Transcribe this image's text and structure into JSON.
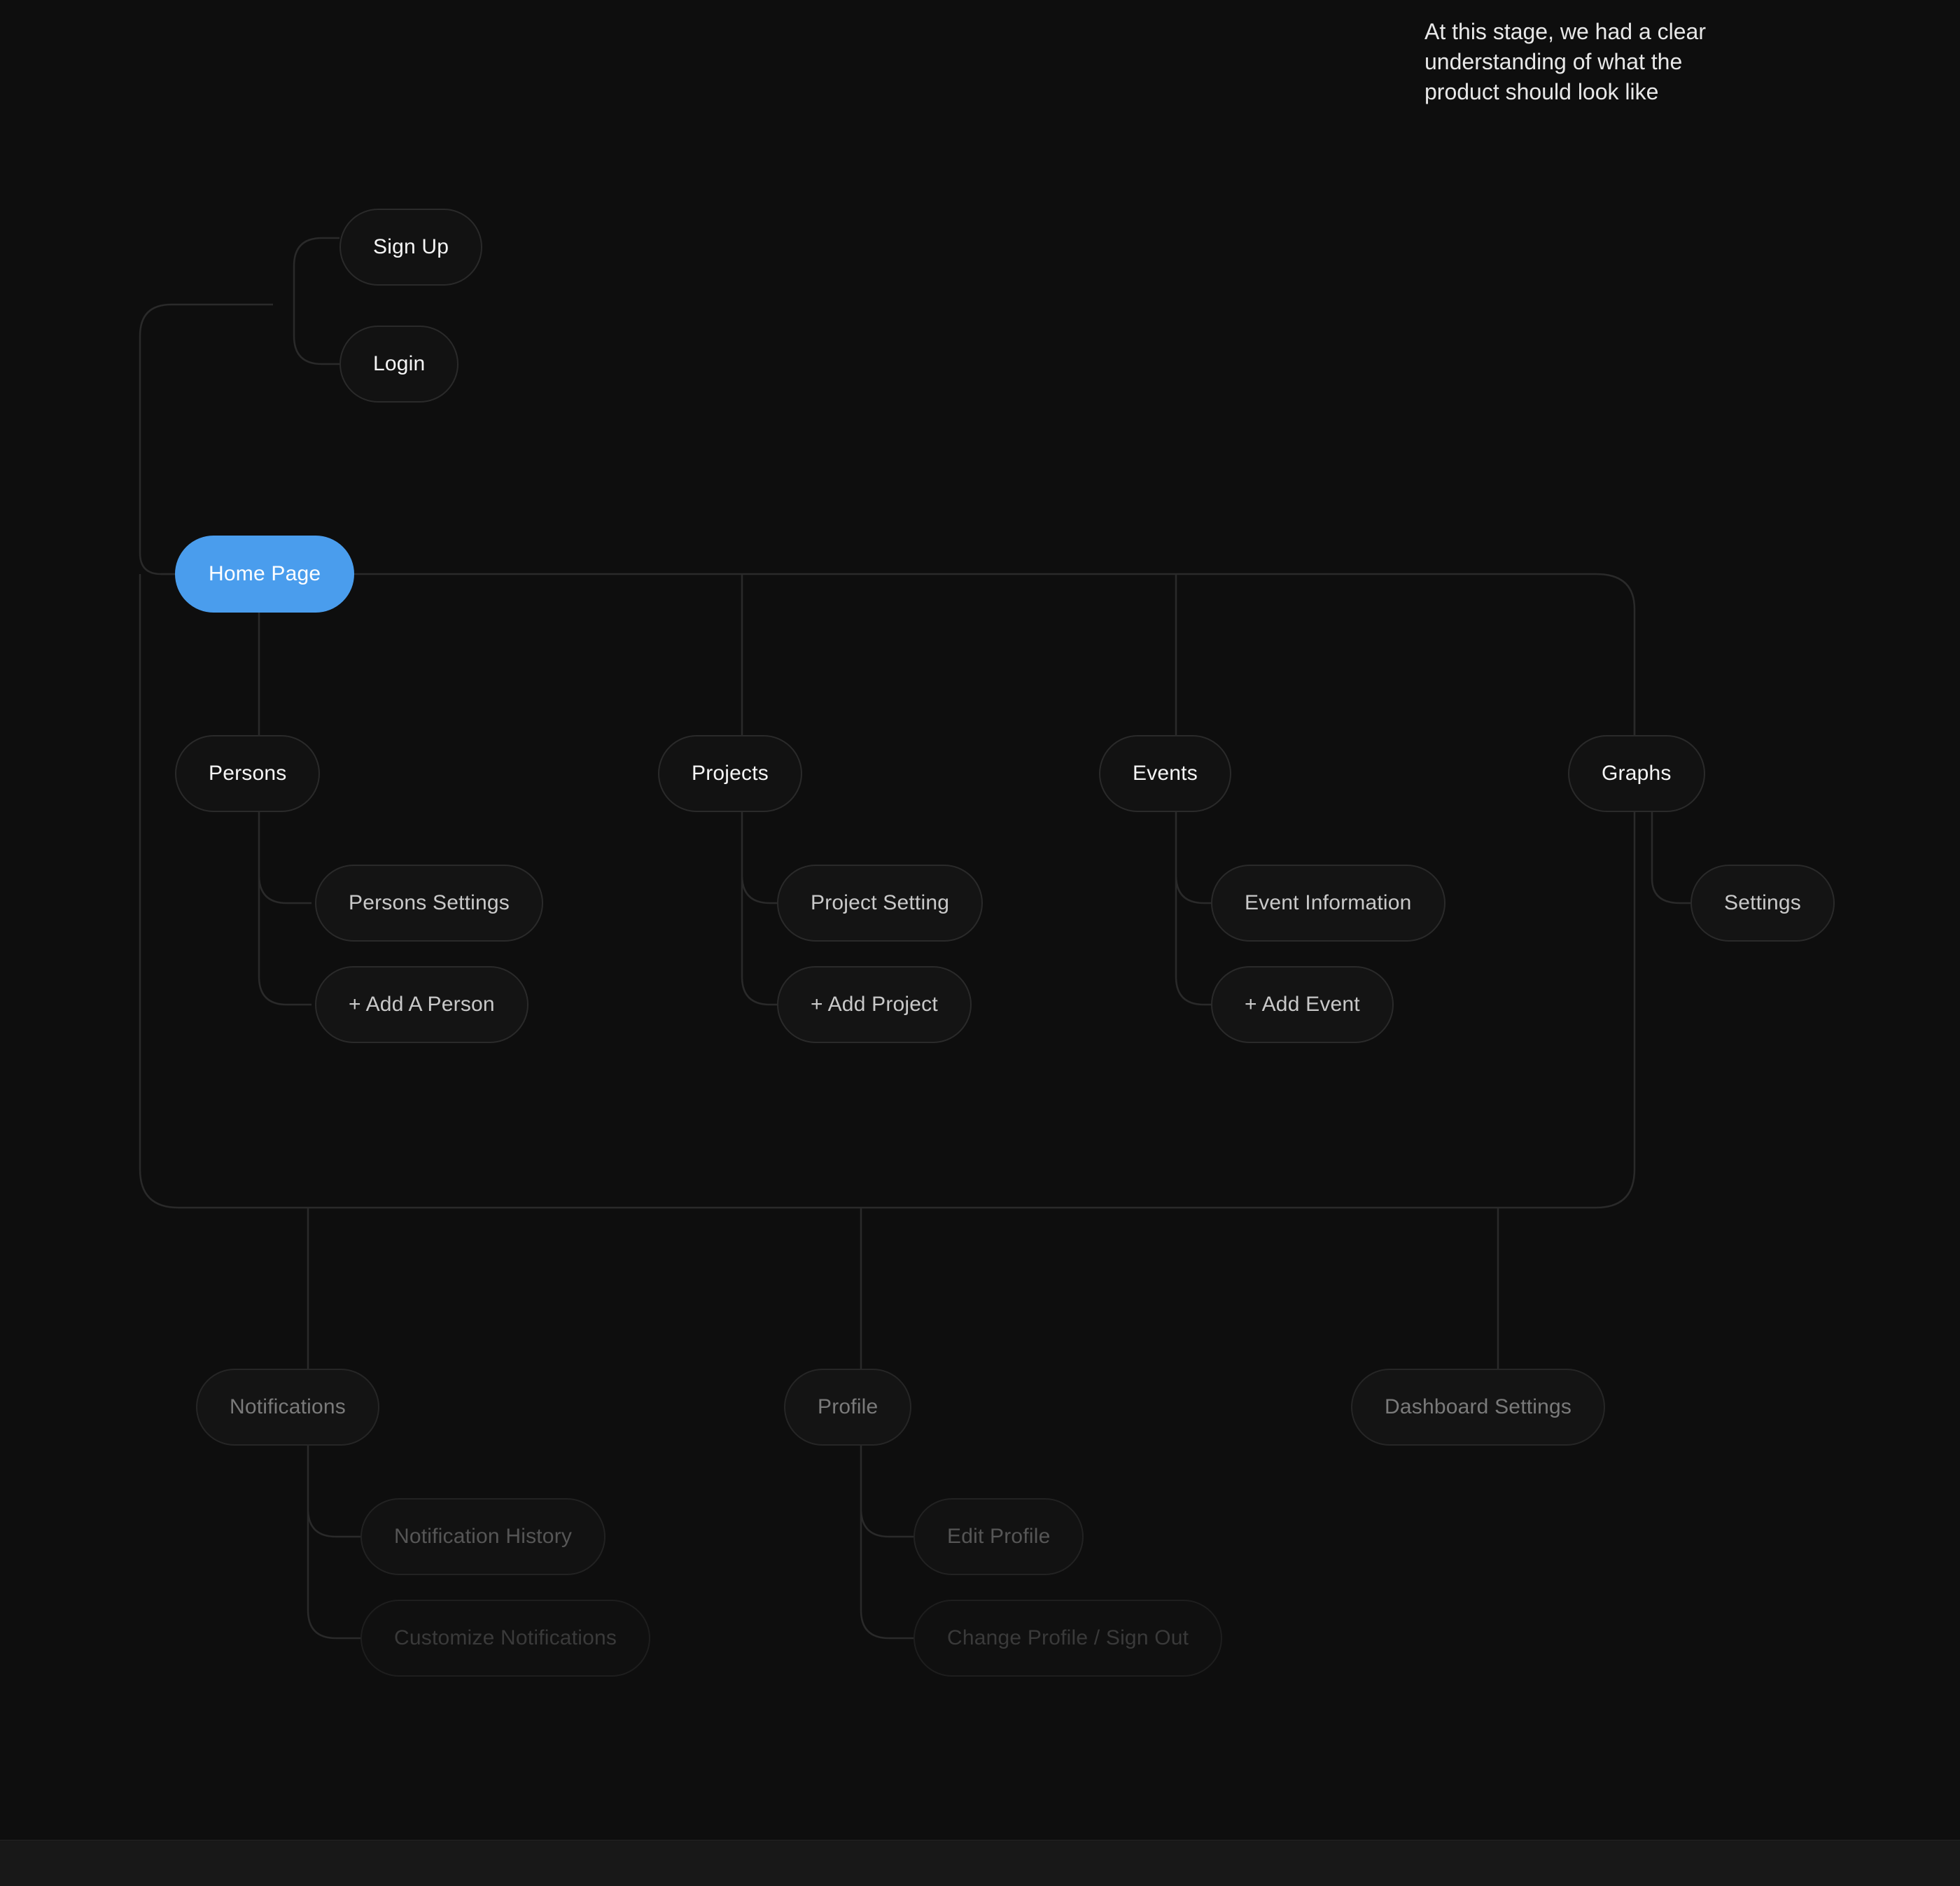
{
  "caption": "At this stage, we had a clear understanding of what the product should look like",
  "nodes": {
    "signup": {
      "label": "Sign Up"
    },
    "login": {
      "label": "Login"
    },
    "home": {
      "label": "Home Page"
    },
    "persons": {
      "label": "Persons"
    },
    "projects": {
      "label": "Projects"
    },
    "events": {
      "label": "Events"
    },
    "graphs": {
      "label": "Graphs"
    },
    "persons_settings": {
      "label": "Persons Settings"
    },
    "persons_add": {
      "label": "+ Add A Person"
    },
    "project_setting": {
      "label": "Project Setting"
    },
    "project_add": {
      "label": "+ Add Project"
    },
    "event_info": {
      "label": "Event Information"
    },
    "event_add": {
      "label": "+ Add Event"
    },
    "graphs_settings": {
      "label": "Settings"
    },
    "notifications": {
      "label": "Notifications"
    },
    "notification_history": {
      "label": "Notification History"
    },
    "customize_notifications": {
      "label": "Customize Notifications"
    },
    "profile": {
      "label": "Profile"
    },
    "edit_profile": {
      "label": "Edit Profile"
    },
    "change_profile": {
      "label": "Change Profile / Sign Out"
    },
    "dashboard_settings": {
      "label": "Dashboard Settings"
    }
  },
  "colors": {
    "bg": "#0e0e0e",
    "accent": "#4a9ded",
    "stroke": "#2a2a2a"
  }
}
